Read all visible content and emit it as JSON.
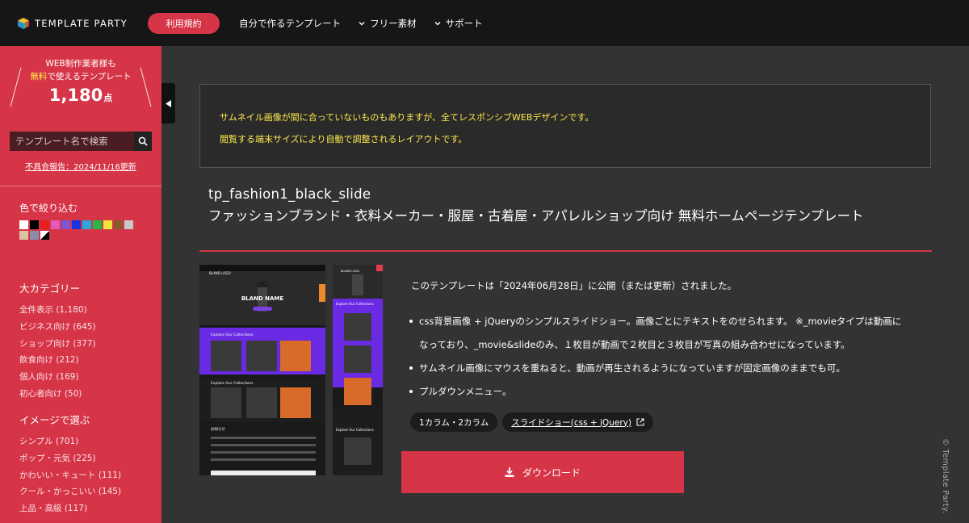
{
  "header": {
    "logo_text": "TEMPLATE PARTY",
    "nav": {
      "terms": "利用規約",
      "make_own": "自分で作るテンプレート",
      "free_materials": "フリー素材",
      "support": "サポート"
    }
  },
  "sidebar": {
    "promo_line1": "WEB制作業者様も",
    "promo_highlight": "無料",
    "promo_line2_rest": "で使えるテンプレート",
    "count": "1,180",
    "count_unit": "点",
    "search_placeholder": "テンプレート名で検索",
    "bug_report": "不具合報告：2024/11/16更新",
    "color_title": "色で絞り込む",
    "colors": [
      "#ffffff",
      "#000000",
      "#e61e1e",
      "#e858b5",
      "#7d55d6",
      "#1636e6",
      "#2aa8d8",
      "#28b446",
      "#f3e33a",
      "#8a5a2e",
      "#c8c8c8",
      "#d8c4a0",
      "#888ea8",
      "#diag"
    ],
    "categories_title": "大カテゴリー",
    "categories": [
      "全件表示 (1,180)",
      "ビジネス向け (645)",
      "ショップ向け (377)",
      "飲食向け (212)",
      "個人向け (169)",
      "初心者向け (50)"
    ],
    "image_title": "イメージで選ぶ",
    "images": [
      "シンプル (701)",
      "ポップ・元気 (225)",
      "かわいい・キュート (111)",
      "クール・かっこいい (145)",
      "上品・高級 (117)"
    ]
  },
  "notice": {
    "line1": "サムネイル画像が間に合っていないものもありますが、全てレスポンシブWEBデザインです。",
    "line2": "閲覧する端末サイズにより自動で調整されるレイアウトです。"
  },
  "template": {
    "name": "tp_fashion1_black_slide",
    "title": "ファッションブランド・衣料メーカー・服屋・古着屋・アパレルショップ向け 無料ホームページテンプレート",
    "published": "このテンプレートは「2024年06月28日」に公開（または更新）されました。",
    "bullets": [
      "css背景画像 + jQueryのシンプルスライドショー。画像ごとにテキストをのせられます。 ※_movieタイプは動画になっており、_movie&slideのみ、１枚目が動画で２枚目と３枚目が写真の組み合わせになっています。",
      "サムネイル画像にマウスを重ねると、動画が再生されるようになっていますが固定画像のままでも可。",
      "プルダウンメニュー。"
    ],
    "tags": [
      "1カラム・2カラム",
      "スライドショー(css + jQuery)"
    ],
    "download": "ダウンロード"
  },
  "preview": {
    "brand": "BLAND NAME",
    "logo": "BLAND LOGO",
    "section": "Explore Our Collections",
    "news": "お知らせ"
  },
  "copyright": "© Template Party."
}
